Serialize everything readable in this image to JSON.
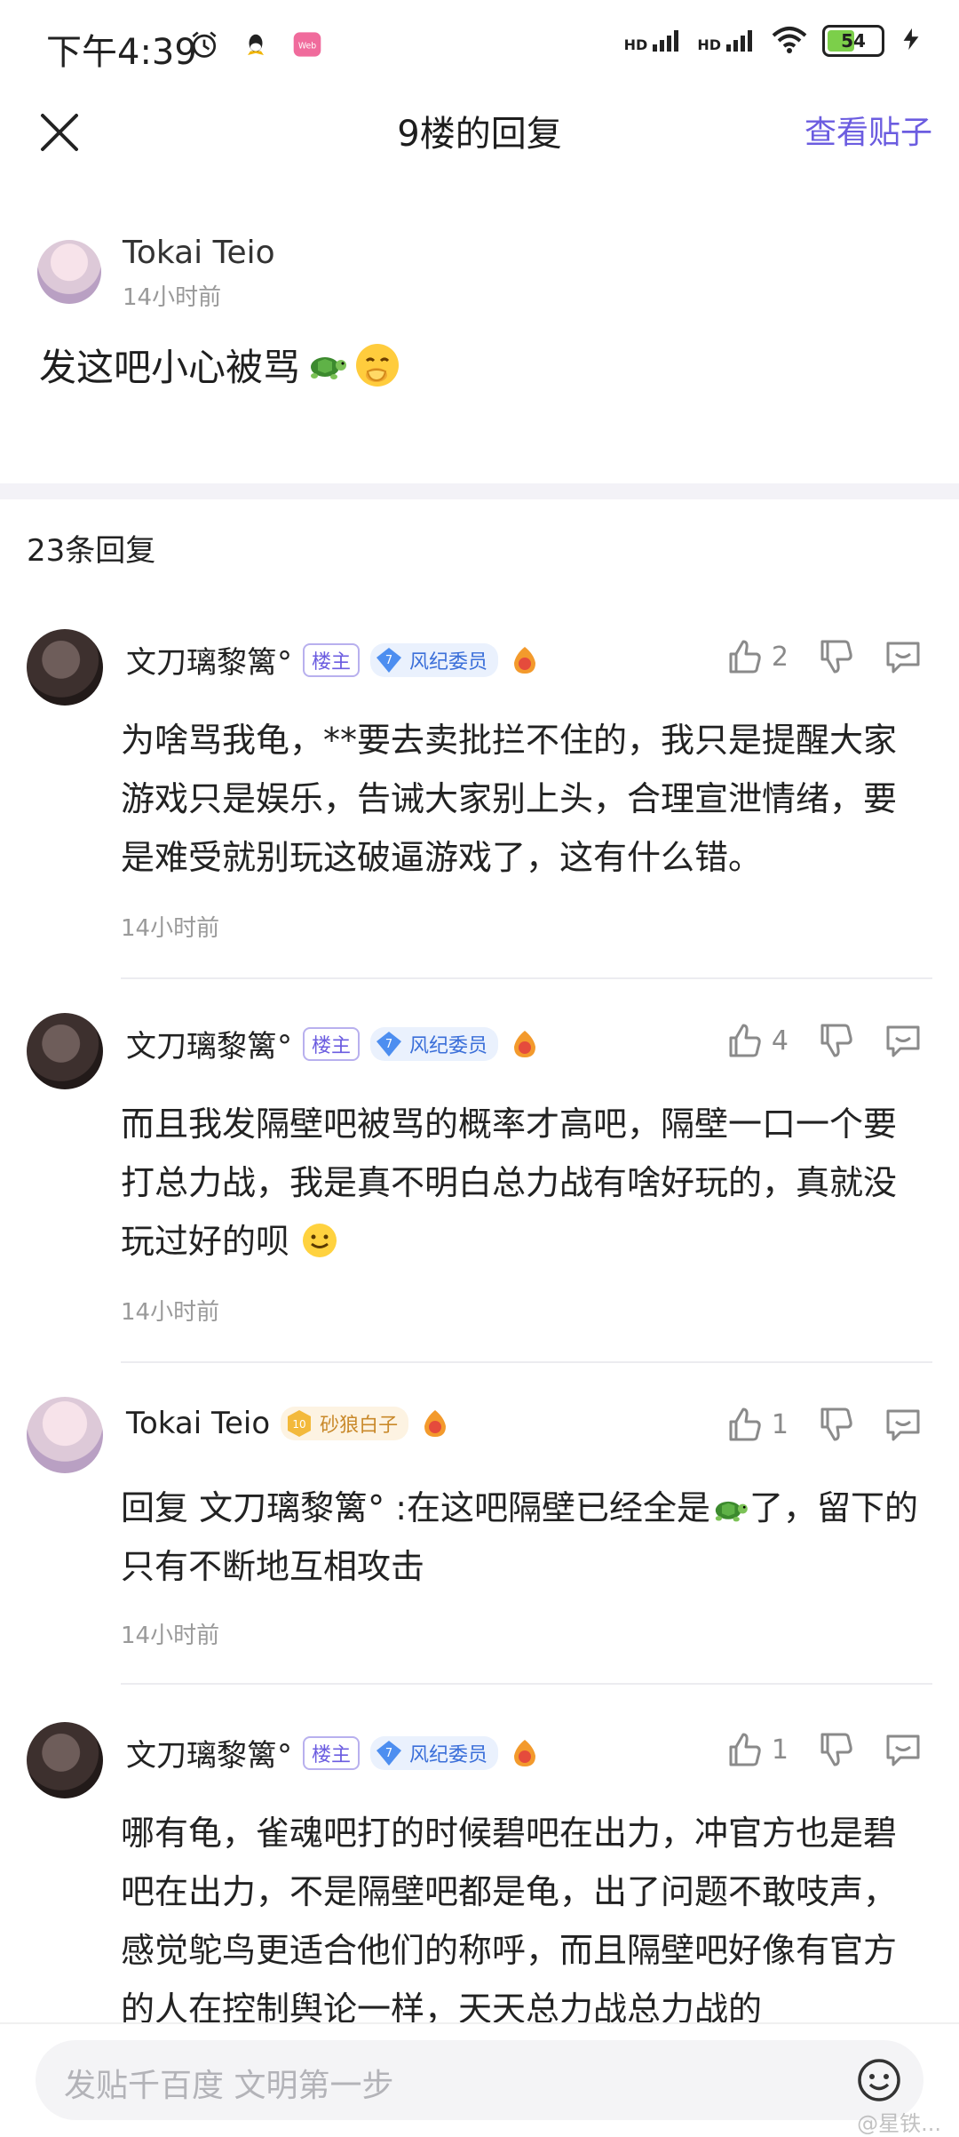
{
  "status_bar": {
    "time": "下午4:39",
    "battery": "54",
    "net_labels": [
      "HD",
      "HD"
    ],
    "icons": [
      "alarm-icon",
      "qq-icon",
      "app-icon",
      "signal-icon",
      "wifi-icon",
      "battery-icon",
      "charging-icon"
    ]
  },
  "header": {
    "title": "9楼的回复",
    "view_post": "查看贴子"
  },
  "post": {
    "author": "Tokai Teio",
    "time": "14小时前",
    "content": "发这吧小心被骂"
  },
  "reply_count": "23条回复",
  "replies": [
    {
      "author": "文刀璃黎篱°",
      "badge_owner": "楼主",
      "level": "7",
      "badge_title": "风纪委员",
      "likes": "2",
      "text": "为啥骂我龟，**要去卖批拦不住的，我只是提醒大家游戏只是娱乐，告诫大家别上头，合理宣泄情绪，要是难受就别玩这破逼游戏了，这有什么错。",
      "time": "14小时前"
    },
    {
      "author": "文刀璃黎篱°",
      "badge_owner": "楼主",
      "level": "7",
      "badge_title": "风纪委员",
      "likes": "4",
      "text": "而且我发隔壁吧被骂的概率才高吧，隔壁一口一个要打总力战，我是真不明白总力战有啥好玩的，真就没玩过好的呗",
      "time": "14小时前"
    },
    {
      "author": "Tokai Teio",
      "level": "10",
      "badge_title": "砂狼白子",
      "likes": "1",
      "text_prefix": "回复 ",
      "text_mention": "文刀璃黎篱°",
      "text_a": " :在这吧隔壁已经全是",
      "text_b": "了，留下的只有不断地互相攻击",
      "time": "14小时前"
    },
    {
      "author": "文刀璃黎篱°",
      "badge_owner": "楼主",
      "level": "7",
      "badge_title": "风纪委员",
      "likes": "1",
      "text": "哪有龟，雀魂吧打的时候碧吧在出力，冲官方也是碧吧在出力，不是隔壁吧都是龟，出了问题不敢吱声，感觉鸵鸟更适合他们的称呼，而且隔壁吧好像有官方的人在控制舆论一样，天天总力战总力战的"
    }
  ],
  "bottom": {
    "placeholder": "发贴千百度 文明第一步",
    "watermark": "@星铁..."
  }
}
